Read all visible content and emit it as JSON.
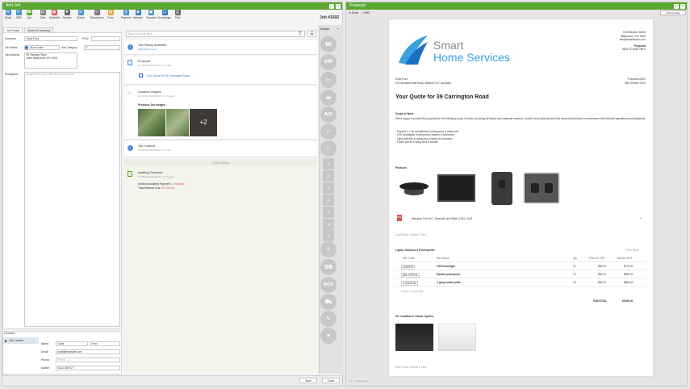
{
  "left": {
    "title": "Add Job",
    "toolbar": [
      "Email",
      "SMS",
      "Call",
      "Task",
      "Schedule",
      "Service",
      "Queue",
      "Recurrence",
      "Form",
      "Payment",
      "Network",
      "Proposal",
      "Knowledge",
      "Print"
    ],
    "tabs": [
      "Job Details",
      "Quotes & Invoicing"
    ],
    "form": {
      "customer_label": "Customer",
      "customer": "Scott Foxx",
      "po_label": "PO #",
      "po": "",
      "status_label": "Job Status",
      "status": "Work Order",
      "category_label": "Job Category",
      "category": "0",
      "address_label": "Job Address",
      "address_line1": "59 Railway Place",
      "address_line2": "West Melbourne VIC 3003",
      "desc_label": "Description",
      "desc_placeholder": "Describe the work that needs to be done"
    },
    "contacts": {
      "header": "Contacts",
      "item": "Job Contact",
      "name_label": "Name:",
      "first": "Scott",
      "last": "Foxx",
      "email_label": "Email:",
      "email": "scott@example.com",
      "phone_label": "Phone:",
      "phone": "Phone",
      "mobile_label": "Mobile:",
      "mobile": "0412 345 677"
    }
  },
  "middle": {
    "job_number": "Job #1692",
    "note_placeholder": "Type a job note here...",
    "badges_label": "Badges",
    "timeline": {
      "history": {
        "title": "Job History Available",
        "link": "Click here to view"
      },
      "proposal": {
        "title": "Proposal",
        "meta": "12:48 PM 19/10/2023 - by Max",
        "link": "Your Quote for 39 Carrington Road"
      },
      "location": {
        "title": "Location Insights",
        "meta": "12:48 PM 19/10/2023 - by System",
        "images_label": "Previous Job Images",
        "more": "+2"
      },
      "created": {
        "title": "Job Created",
        "meta": "12:21 PM 19/10/2023 - by Max"
      },
      "divider": "Client Diary",
      "payment": {
        "title": "Awaiting Payment",
        "meta": "12:48 PM 19/10/2023 - by System",
        "line1": "Invoices Awaiting Payment:",
        "line1_val": "2 Invoices",
        "line2": "Total Balance Due:",
        "line2_val": "$1,430.00"
      }
    },
    "badges": [
      "W",
      "VIP",
      "",
      "",
      "",
      "A/C",
      "",
      "",
      "",
      "",
      "",
      "",
      "",
      "",
      "",
      "",
      "",
      "",
      "SB",
      "HCV",
      "",
      "",
      "",
      "",
      ""
    ],
    "save": "Save",
    "close": "Close"
  },
  "right": {
    "title": "Proposal",
    "tabs": [
      "Email",
      "SMS"
    ],
    "side_btn": "Side by Side",
    "logo": {
      "line1": "Smart",
      "line2": "Home Services"
    },
    "company": {
      "l1": "76 Exhibition Street",
      "l2": "Melbourne, VIC 3000",
      "l3": "info@smarthome.com",
      "heading": "Proposal",
      "abn": "ABN 12 3456 789 0"
    },
    "client": {
      "name": "Scott Foxx",
      "address": "23 Doncaster East Road, Mitcham VIC, Australia"
    },
    "proposal_ref": {
      "no": "Proposal #1692",
      "date": "19th October 2023"
    },
    "heading": "Your Quote for 39 Carrington Road",
    "scope": {
      "title": "Scope of Work",
      "body": "We're happy to provide this proposal for the following scope of works, including all labour and materials required, carried out by fully licensed and insured technicians in accordance with relevant regulations and standards:",
      "bullets": [
        "- Replace 4 x air conditioners in living area & bedrooms",
        "- LED downlights in living area, kitchen & bedrooms",
        "- Light switches in living area, kitchen & bedrooms",
        "- Power points in living area & kitchen"
      ]
    },
    "products": {
      "title": "Products",
      "file": "Warranty Card AU - Domestic and Skyfer 1263_0.pdf",
      "add": "Add Photos, Videos & Files"
    },
    "lights": {
      "title": "Lights, Switches & Powerpoints",
      "fixed": "Fixed Items",
      "headers": [
        "Item Code",
        "Item Name",
        "Qty",
        "Price AC GST",
        "Total Inc GST"
      ],
      "rows": [
        [
          "LED9075",
          "LED Downlight",
          "14",
          "$55.00",
          "$770.00"
        ],
        [
          "DBL-GPO-BL",
          "Double powerpoint",
          "10",
          "$65.00",
          "$650.00"
        ],
        [
          "2-GANG BL",
          "2-gang switch plate",
          "16",
          "$35.00",
          "$560.00"
        ]
      ],
      "search": "Search or Add Item...",
      "subtotal_label": "SUBTOTAL",
      "subtotal": "$1980.00"
    },
    "aircon": {
      "title": "Air Conditioner Colour Options",
      "add": "Add Photos, Videos & Files"
    },
    "footer": "Auto-saved"
  },
  "colors": {
    "accent": "#5aa832",
    "link": "#2a76c6",
    "alert": "#d9534f",
    "logo": "#3aa0e0"
  }
}
